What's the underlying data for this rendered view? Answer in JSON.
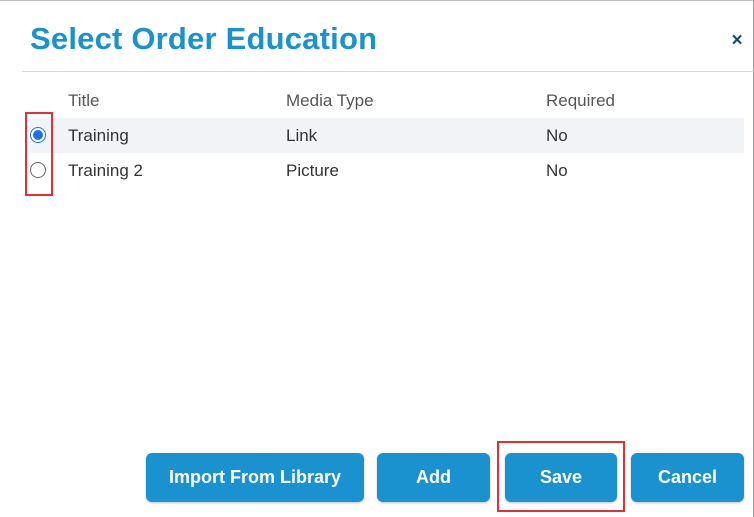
{
  "dialog": {
    "title": "Select Order Education",
    "close_label": "×"
  },
  "grid": {
    "columns": [
      "Title",
      "Media Type",
      "Required"
    ],
    "rows": [
      {
        "title": "Training",
        "media_type": "Link",
        "required": "No",
        "selected": true
      },
      {
        "title": "Training 2",
        "media_type": "Picture",
        "required": "No",
        "selected": false
      }
    ]
  },
  "buttons": {
    "import": "Import From Library",
    "add": "Add",
    "save": "Save",
    "cancel": "Cancel"
  },
  "colors": {
    "accent": "#1a92cf",
    "highlight": "#e0303a",
    "radio_checked": "#1a73e8"
  }
}
